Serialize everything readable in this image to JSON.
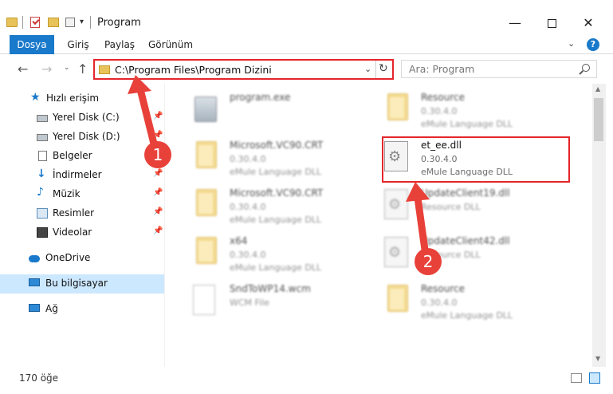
{
  "window": {
    "title": "Program",
    "minimize_glyph": "—",
    "close_glyph": "✕"
  },
  "ribbon": {
    "tabs": [
      "Dosya",
      "Giriş",
      "Paylaş",
      "Görünüm"
    ],
    "expand_glyph": "⌄",
    "help_glyph": "?"
  },
  "nav": {
    "back_glyph": "←",
    "forward_glyph": "→",
    "recent_glyph": "⌄",
    "up_glyph": "↑",
    "address": "C:\\Program Files\\Program Dizini",
    "address_chevron": "⌄",
    "refresh_glyph": "↻",
    "search_placeholder": "Ara: Program"
  },
  "sidebar": {
    "items": [
      {
        "label": "Hızlı erişim",
        "icon": "star-icon"
      },
      {
        "label": "Yerel Disk (C:)",
        "icon": "drive-icon",
        "pinned": true
      },
      {
        "label": "Yerel Disk (D:)",
        "icon": "drive-icon",
        "pinned": true
      },
      {
        "label": "Belgeler",
        "icon": "documents-icon",
        "pinned": true
      },
      {
        "label": "İndirmeler",
        "icon": "downloads-icon",
        "pinned": true
      },
      {
        "label": "Müzik",
        "icon": "music-icon",
        "pinned": true
      },
      {
        "label": "Resimler",
        "icon": "pictures-icon",
        "pinned": true
      },
      {
        "label": "Videolar",
        "icon": "videos-icon",
        "pinned": true
      },
      {
        "label": "OneDrive",
        "icon": "onedrive-icon"
      },
      {
        "label": "Bu bilgisayar",
        "icon": "this-pc-icon",
        "selected": true
      },
      {
        "label": "Ağ",
        "icon": "network-icon"
      }
    ],
    "pin_glyph": "📌"
  },
  "files": [
    {
      "name": "program.exe",
      "line2": "",
      "line3": "",
      "icon": "exe-icon",
      "blurred": true
    },
    {
      "name": "Resource",
      "line2": "0.30.4.0",
      "line3": "eMule Language DLL",
      "icon": "folder-icon",
      "blurred": true
    },
    {
      "name": "Microsoft.VC90.CRT",
      "line2": "0.30.4.0",
      "line3": "eMule Language DLL",
      "icon": "folder-icon",
      "blurred": true
    },
    {
      "name": "et_ee.dll",
      "line2": "0.30.4.0",
      "line3": "eMule Language DLL",
      "icon": "dll-icon",
      "blurred": false,
      "highlighted": true
    },
    {
      "name": "Microsoft.VC90.CRT",
      "line2": "0.30.4.0",
      "line3": "eMule Language DLL",
      "icon": "folder-icon",
      "blurred": true
    },
    {
      "name": "UpdateClient19.dll",
      "line2": "Resource DLL",
      "line3": "",
      "icon": "dll-icon",
      "blurred": true
    },
    {
      "name": "x64",
      "line2": "0.30.4.0",
      "line3": "eMule Language DLL",
      "icon": "folder-icon",
      "blurred": true
    },
    {
      "name": "UpdateClient42.dll",
      "line2": "Resource DLL",
      "line3": "",
      "icon": "dll-icon",
      "blurred": true
    },
    {
      "name": "SndToWP14.wcm",
      "line2": "WCM File",
      "line3": "",
      "icon": "file-icon",
      "blurred": true
    },
    {
      "name": "Resource",
      "line2": "0.30.4.0",
      "line3": "eMule Language DLL",
      "icon": "folder-icon",
      "blurred": true
    }
  ],
  "annotations": {
    "marker_1": "1",
    "marker_2": "2",
    "accent_color": "#e4262c"
  },
  "statusbar": {
    "item_count": "170 öğe"
  },
  "colors": {
    "accent": "#1979ca",
    "selection": "#cce8ff"
  }
}
